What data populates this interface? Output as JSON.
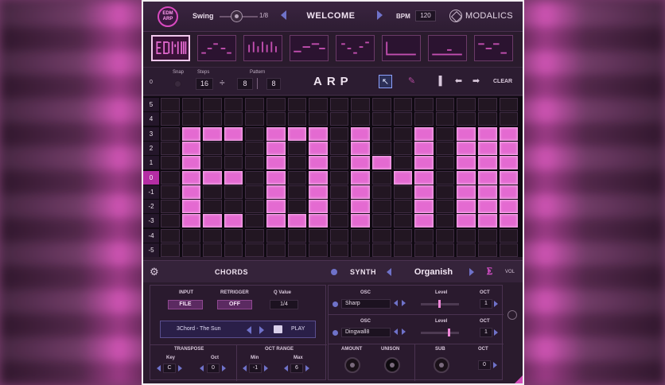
{
  "header": {
    "logo_line1": "EDM",
    "logo_line2": "ARP",
    "swing_label": "Swing",
    "swing_value": "1/8",
    "preset_name": "WELCOME",
    "bpm_label": "BPM",
    "bpm_value": "120",
    "brand": "MODALICS"
  },
  "patterns": {
    "count": 8,
    "selected_index": 0
  },
  "toolbar": {
    "left_value": "0",
    "snap_label": "Snap",
    "steps_label": "Steps",
    "steps_value": "16",
    "divide_symbol": "÷",
    "divide_value": "8",
    "pattern_label": "Pattern",
    "pattern_value": "8",
    "title": "ARP",
    "tools": [
      "pointer-icon",
      "pencil-icon",
      "velocity-icon",
      "arrow-left-icon",
      "arrow-right-icon"
    ],
    "clear_label": "CLEAR"
  },
  "grid": {
    "row_labels": [
      "5",
      "4",
      "3",
      "2",
      "1",
      "0",
      "-1",
      "-2",
      "-3",
      "-4",
      "-5"
    ],
    "highlight_row": "0",
    "active_cells": [
      [
        2,
        1
      ],
      [
        2,
        2
      ],
      [
        2,
        3
      ],
      [
        2,
        5
      ],
      [
        2,
        6
      ],
      [
        2,
        7
      ],
      [
        2,
        9
      ],
      [
        2,
        12
      ],
      [
        2,
        14
      ],
      [
        2,
        15
      ],
      [
        2,
        16
      ],
      [
        3,
        1
      ],
      [
        3,
        5
      ],
      [
        3,
        7
      ],
      [
        3,
        9
      ],
      [
        3,
        12
      ],
      [
        3,
        14
      ],
      [
        3,
        15
      ],
      [
        3,
        16
      ],
      [
        4,
        1
      ],
      [
        4,
        5
      ],
      [
        4,
        7
      ],
      [
        4,
        9
      ],
      [
        4,
        10
      ],
      [
        4,
        12
      ],
      [
        4,
        14
      ],
      [
        4,
        15
      ],
      [
        4,
        16
      ],
      [
        5,
        1
      ],
      [
        5,
        2
      ],
      [
        5,
        3
      ],
      [
        5,
        5
      ],
      [
        5,
        7
      ],
      [
        5,
        9
      ],
      [
        5,
        11
      ],
      [
        5,
        12
      ],
      [
        5,
        14
      ],
      [
        5,
        15
      ],
      [
        5,
        16
      ],
      [
        6,
        1
      ],
      [
        6,
        5
      ],
      [
        6,
        7
      ],
      [
        6,
        9
      ],
      [
        6,
        12
      ],
      [
        6,
        14
      ],
      [
        6,
        15
      ],
      [
        6,
        16
      ],
      [
        7,
        1
      ],
      [
        7,
        5
      ],
      [
        7,
        7
      ],
      [
        7,
        9
      ],
      [
        7,
        12
      ],
      [
        7,
        14
      ],
      [
        7,
        15
      ],
      [
        7,
        16
      ],
      [
        8,
        1
      ],
      [
        8,
        2
      ],
      [
        8,
        3
      ],
      [
        8,
        5
      ],
      [
        8,
        6
      ],
      [
        8,
        7
      ],
      [
        8,
        9
      ],
      [
        8,
        12
      ],
      [
        8,
        14
      ],
      [
        8,
        15
      ],
      [
        8,
        16
      ]
    ],
    "accent": "#e46ad1"
  },
  "midbar": {
    "chords_title": "CHORDS",
    "synth_title": "SYNTH",
    "synth_preset": "Organish",
    "vol_label": "VOL"
  },
  "chords": {
    "input_label": "INPUT",
    "input_value": "FILE",
    "retrigger_label": "RETRIGGER",
    "retrigger_value": "OFF",
    "qvalue_label": "Q Value",
    "qvalue_value": "1/4",
    "chord_preset": "3Chord - The Sun",
    "play_label": "PLAY",
    "transpose_label": "TRANSPOSE",
    "key_label": "Key",
    "key_value": "C",
    "oct_label": "Oct",
    "oct_value": "0",
    "octrange_label": "OCT RANGE",
    "min_label": "Min",
    "min_value": "-1",
    "max_label": "Max",
    "max_value": "6"
  },
  "synth": {
    "osc_label": "OSC",
    "level_label": "Level",
    "oct_label": "OCT",
    "osc1_value": "Sharp",
    "osc1_oct": "1",
    "osc2_value": "Dingwall8",
    "osc2_oct": "1",
    "amount_label": "AMOUNT",
    "unison_label": "UNISON",
    "sub_label": "SUB",
    "sub_oct": "0"
  }
}
